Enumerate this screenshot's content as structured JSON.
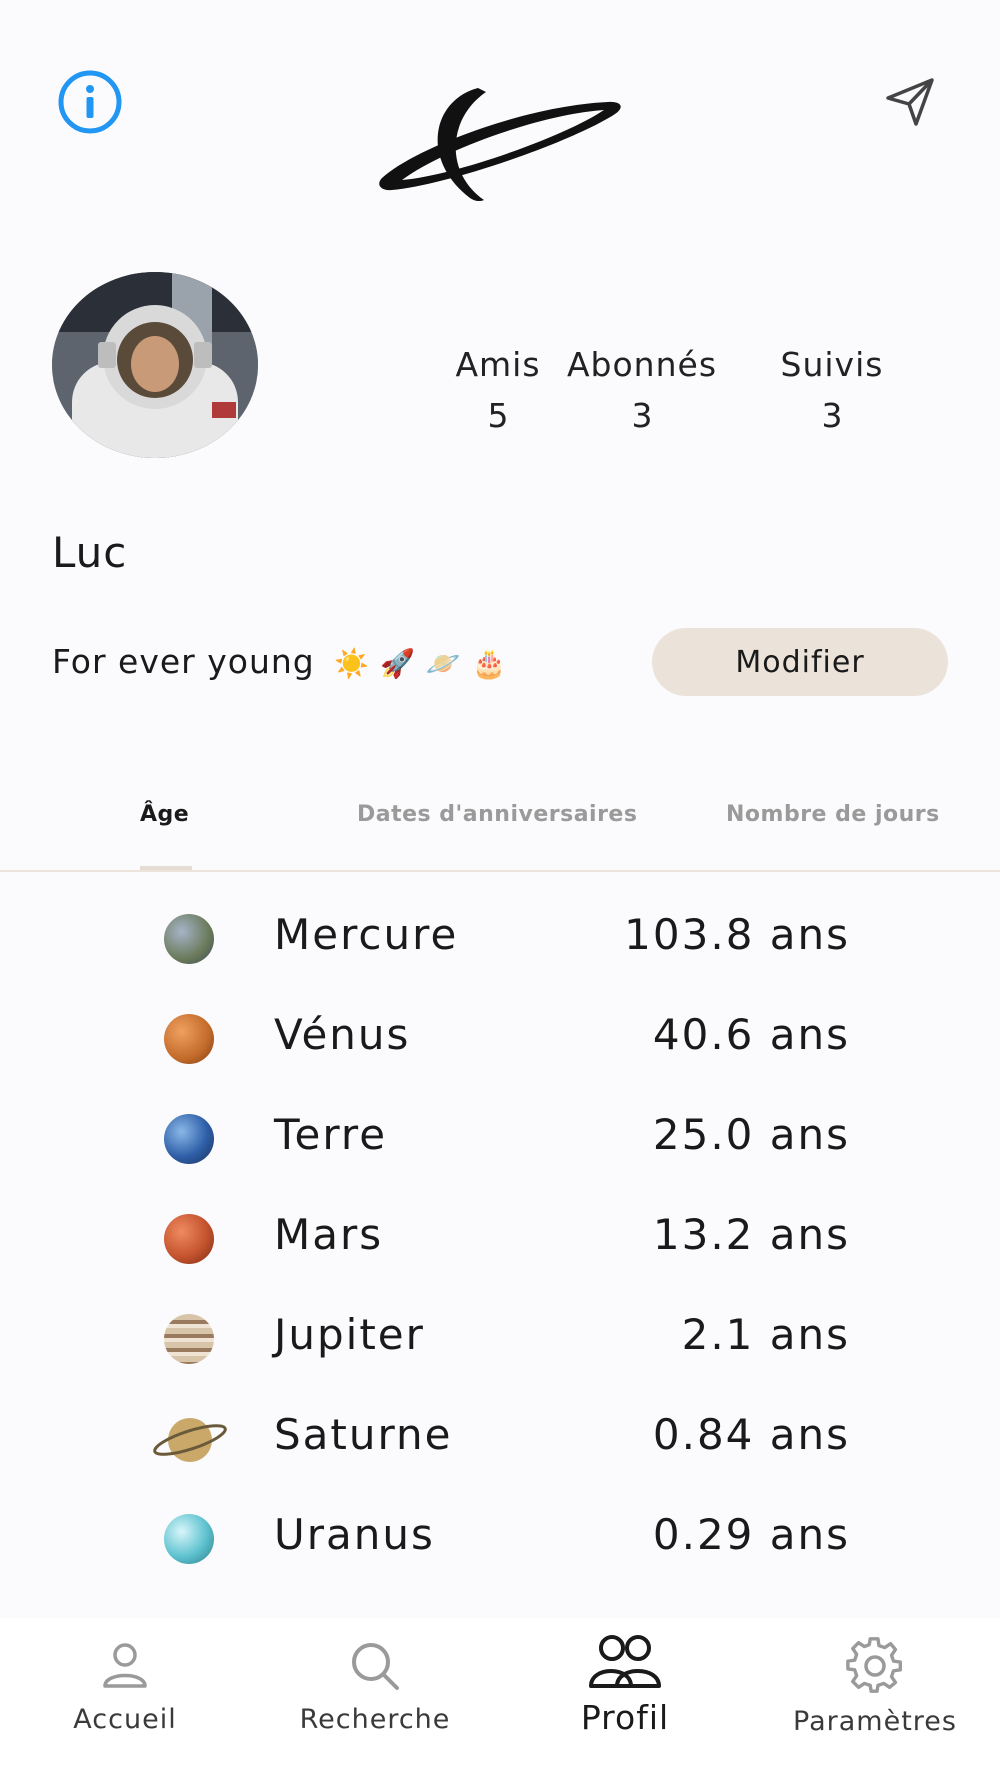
{
  "header": {
    "info_icon": "info-circle-icon",
    "send_icon": "paper-plane-icon",
    "logo_icon": "planet-ring-logo"
  },
  "profile": {
    "avatar_icon": "astronaut-avatar",
    "username": "Luc",
    "bio": "For ever young",
    "bio_emojis": "☀️ 🚀 🪐 🎂",
    "edit_button": "Modifier",
    "stats": {
      "amis_label": "Amis",
      "amis_value": "5",
      "abonnes_label": "Abonnés",
      "abonnes_value": "3",
      "suivis_label": "Suivis",
      "suivis_value": "3"
    }
  },
  "tabs": [
    {
      "label": "Âge",
      "active": true
    },
    {
      "label": "Dates d'anniversaires",
      "active": false
    },
    {
      "label": "Nombre de jours",
      "active": false
    }
  ],
  "planets": [
    {
      "name": "Mercure",
      "age": "103.8 ans",
      "color": "#8a7a5a"
    },
    {
      "name": "Vénus",
      "age": "40.6 ans",
      "color": "#c26a2a"
    },
    {
      "name": "Terre",
      "age": "25.0 ans",
      "color": "#2f5fa8"
    },
    {
      "name": "Mars",
      "age": "13.2 ans",
      "color": "#c4542e"
    },
    {
      "name": "Jupiter",
      "age": "2.1 ans",
      "color": "#a58a70"
    },
    {
      "name": "Saturne",
      "age": "0.84 ans",
      "color": "#c9a86a"
    },
    {
      "name": "Uranus",
      "age": "0.29 ans",
      "color": "#5ec2cf"
    }
  ],
  "nav": {
    "accueil": "Accueil",
    "recherche": "Recherche",
    "profil": "Profil",
    "parametres": "Paramètres"
  },
  "colors": {
    "accent": "#2196f3",
    "button_bg": "#ebe3da",
    "tab_active": "#1a1a1a",
    "tab_inactive": "#9a9a9a"
  }
}
